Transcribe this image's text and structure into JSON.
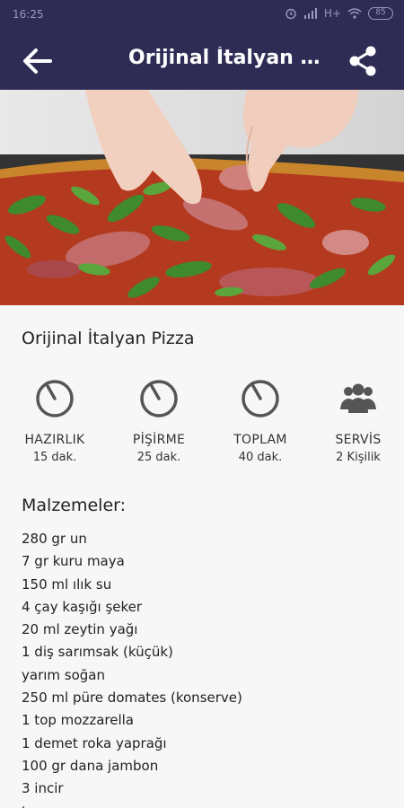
{
  "status_bar": {
    "time": "16:25",
    "battery": "85",
    "network": "H+"
  },
  "app_bar": {
    "title": "Orijinal İtalyan Pizza"
  },
  "recipe": {
    "title": "Orijinal İtalyan Pizza"
  },
  "stats": [
    {
      "label": "HAZIRLIK",
      "value": "15 dak.",
      "icon": "timer-icon"
    },
    {
      "label": "PİŞİRME",
      "value": "25 dak.",
      "icon": "timer-icon"
    },
    {
      "label": "TOPLAM",
      "value": "40 dak.",
      "icon": "timer-icon"
    },
    {
      "label": "SERVİS",
      "value": "2 Kişilik",
      "icon": "people-icon"
    }
  ],
  "ingredients_title": "Malzemeler:",
  "ingredients": [
    "280 gr un",
    "7 gr kuru maya",
    "150 ml ılık su",
    "4 çay kaşığı şeker",
    "20 ml zeytin yağı",
    "1 diş sarımsak (küçük)",
    "yarım soğan",
    "250 ml püre domates (konserve)",
    "1 top mozzarella",
    "1 demet roka yaprağı",
    "100 gr dana jambon",
    "3 incir",
    "tuz"
  ],
  "colors": {
    "app_bar": "#2e2c55",
    "icon_gray": "#555555",
    "background": "#f7f7f7"
  }
}
